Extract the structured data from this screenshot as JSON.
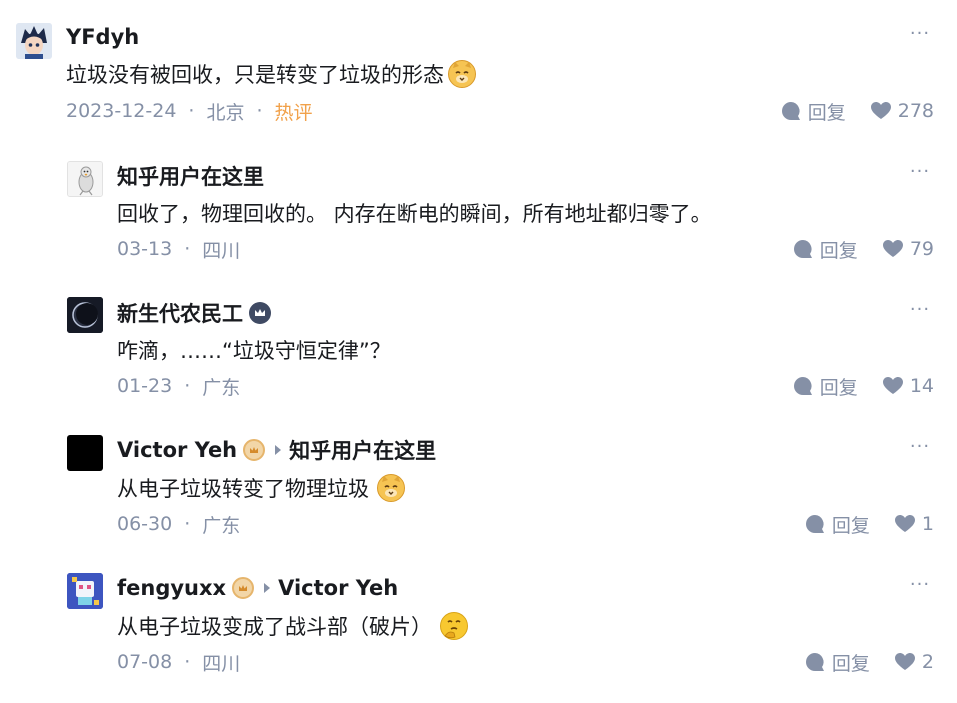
{
  "more_label": "···",
  "reply_label": "回复",
  "comments": [
    {
      "name": "YFdyh",
      "content": "垃圾没有被回收，只是转变了垃圾的形态",
      "emoji": "cat-emoji",
      "date": "2023-12-24",
      "location": "北京",
      "hot": "热评",
      "likes": "278"
    },
    {
      "name": "知乎用户在这里",
      "content": "回收了，物理回收的。 内存在断电的瞬间，所有地址都归零了。",
      "date": "03-13",
      "location": "四川",
      "likes": "79"
    },
    {
      "name": "新生代农民工",
      "badge": "crown-badge",
      "content": "咋滴，……“垃圾守恒定律”？",
      "date": "01-23",
      "location": "广东",
      "likes": "14"
    },
    {
      "name": "Victor Yeh",
      "badge": "gold-badge",
      "reply_to": "知乎用户在这里",
      "content": "从电子垃圾转变了物理垃圾",
      "emoji": "cat-emoji",
      "date": "06-30",
      "location": "广东",
      "likes": "1"
    },
    {
      "name": "fengyuxx",
      "badge": "gold-badge",
      "reply_to": "Victor Yeh",
      "content": "从电子垃圾变成了战斗部（破片）",
      "emoji": "thinking-emoji",
      "date": "07-08",
      "location": "四川",
      "likes": "2"
    }
  ],
  "colors": {
    "text": "#191b1f",
    "meta": "#8590a6",
    "hot": "#f1a14a"
  }
}
